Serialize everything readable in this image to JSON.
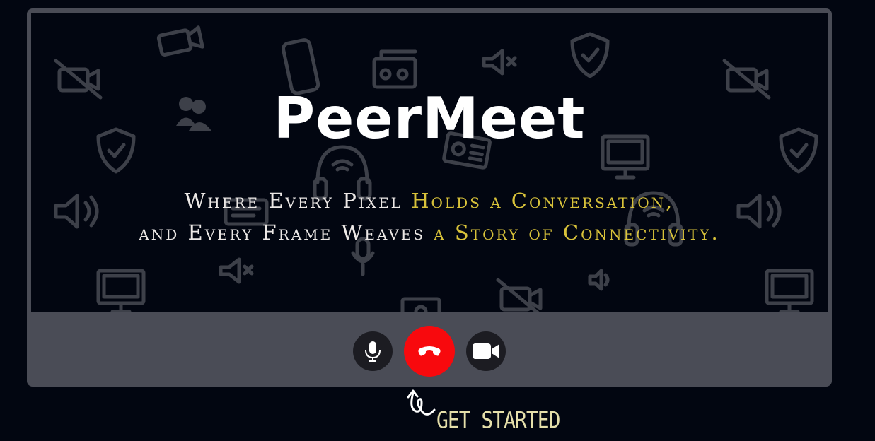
{
  "app": {
    "title": "PeerMeet",
    "tagline": {
      "line1_plain": "Where Every Pixel ",
      "line1_highlight": "Holds a Conversation,",
      "line2_plain": "and Every Frame Weaves ",
      "line2_highlight": "a Story of Connectivity."
    }
  },
  "controls": {
    "mic_icon": "microphone-icon",
    "end_call_icon": "phone-hangup-icon",
    "camera_icon": "video-camera-icon"
  },
  "cta": {
    "label": "GET STARTED",
    "arrow_icon": "curly-arrow-up-icon"
  },
  "colors": {
    "background": "#020611",
    "frame": "#4a4c56",
    "end_call": "#f8090d",
    "highlight": "#d8c23a",
    "cta_text": "#e5dfaa"
  }
}
